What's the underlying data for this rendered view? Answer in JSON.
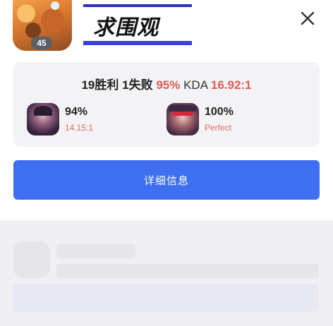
{
  "header": {
    "level": "45",
    "title": "求围观"
  },
  "stats": {
    "wins": "19胜利",
    "losses": "1失败",
    "win_rate": "95%",
    "kda_label": "KDA",
    "kda_value": "16.92:1"
  },
  "heroes": [
    {
      "win_rate": "94%",
      "kda": "14.15:1"
    },
    {
      "win_rate": "100%",
      "kda": "Perfect"
    }
  ],
  "actions": {
    "details_label": "详细信息"
  },
  "colors": {
    "accent_blue": "#3d6ff0",
    "highlight_red": "#e05a55",
    "banner_underline": "#3a3ee6"
  }
}
